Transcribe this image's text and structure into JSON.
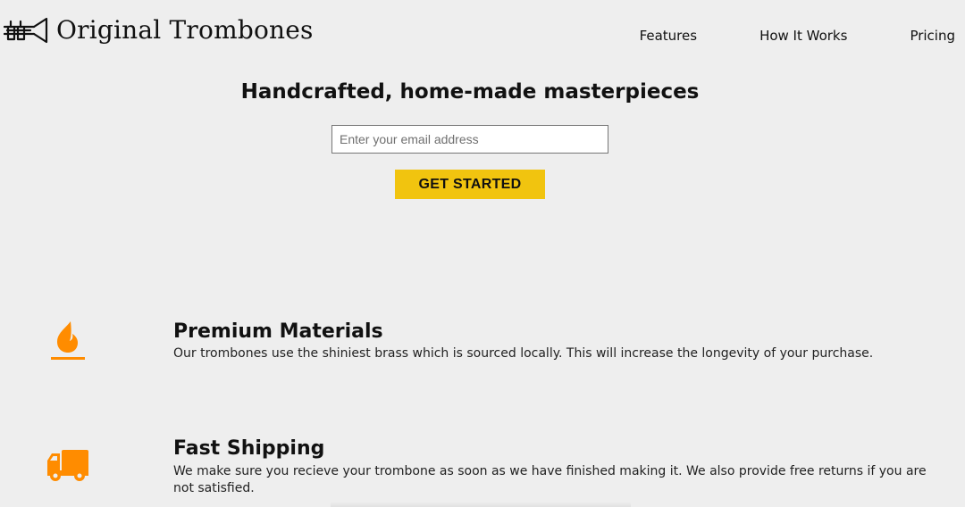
{
  "brand": {
    "name": "Original Trombones",
    "logo_icon": "trombone-icon"
  },
  "nav": {
    "items": [
      {
        "label": "Features"
      },
      {
        "label": "How It Works"
      },
      {
        "label": "Pricing"
      }
    ]
  },
  "hero": {
    "title": "Handcrafted, home-made masterpieces",
    "email_placeholder": "Enter your email address",
    "email_value": "",
    "cta_label": "GET STARTED"
  },
  "features": [
    {
      "icon": "fire-icon",
      "title": "Premium Materials",
      "description": "Our trombones use the shiniest brass which is sourced locally. This will increase the longevity of your purchase."
    },
    {
      "icon": "truck-icon",
      "title": "Fast Shipping",
      "description": "We make sure you recieve your trombone as soon as we have finished making it. We also provide free returns if you are not satisfied."
    }
  ],
  "colors": {
    "background": "#eeeeee",
    "accent": "#f1c40f",
    "icon": "#ff8c00"
  }
}
